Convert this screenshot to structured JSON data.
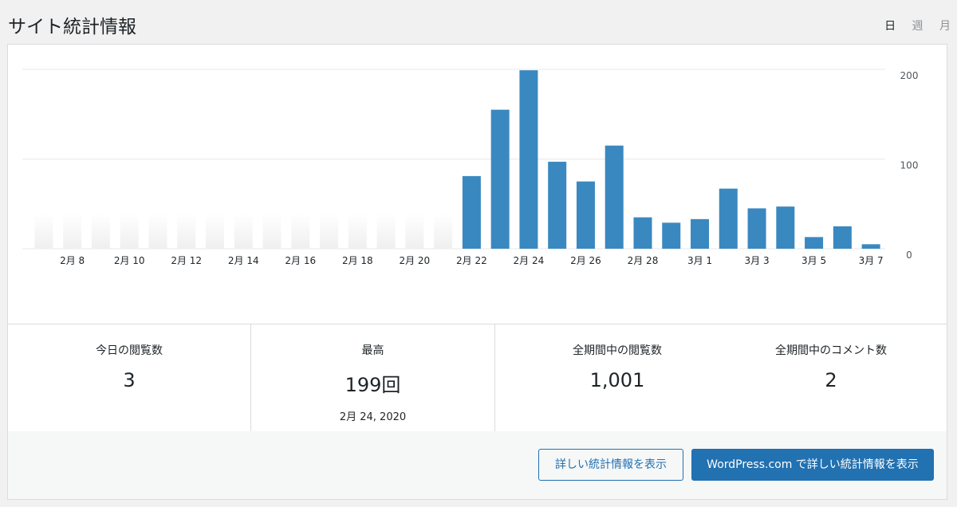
{
  "header": {
    "title": "サイト統計情報",
    "periods": [
      "日",
      "週",
      "月"
    ],
    "active_period": "日"
  },
  "chart_data": {
    "type": "bar",
    "categories": [
      "2月7",
      "2月8",
      "2月9",
      "2月10",
      "2月11",
      "2月12",
      "2月13",
      "2月14",
      "2月15",
      "2月16",
      "2月17",
      "2月18",
      "2月19",
      "2月20",
      "2月21",
      "2月22",
      "2月23",
      "2月24",
      "2月25",
      "2月26",
      "2月27",
      "2月28",
      "2月29",
      "3月1",
      "3月2",
      "3月3",
      "3月4",
      "3月5",
      "3月6",
      "3月7"
    ],
    "values": [
      0,
      0,
      0,
      0,
      0,
      0,
      0,
      0,
      0,
      0,
      0,
      0,
      0,
      0,
      0,
      81,
      155,
      199,
      97,
      75,
      115,
      35,
      29,
      33,
      67,
      45,
      47,
      13,
      25,
      5
    ],
    "x_tick_labels": [
      "2月 8",
      "2月 10",
      "2月 12",
      "2月 14",
      "2月 16",
      "2月 18",
      "2月 20",
      "2月 22",
      "2月 24",
      "2月 26",
      "2月 28",
      "3月 1",
      "3月 3",
      "3月 5",
      "3月 7"
    ],
    "y_ticks": [
      "200",
      "100",
      "0"
    ],
    "ylim": [
      0,
      200
    ],
    "bar_color": "#3a88c0",
    "grid": true
  },
  "stats": {
    "today_label": "今日の閲覧数",
    "today_value": "3",
    "best_label": "最高",
    "best_value": "199回",
    "best_date": "2月 24, 2020",
    "total_views_label": "全期間中の閲覧数",
    "total_views_value": "1,001",
    "total_comments_label": "全期間中のコメント数",
    "total_comments_value": "2"
  },
  "buttons": {
    "details": "詳しい統計情報を表示",
    "wpcom_details": "WordPress.com で詳しい統計情報を表示"
  }
}
